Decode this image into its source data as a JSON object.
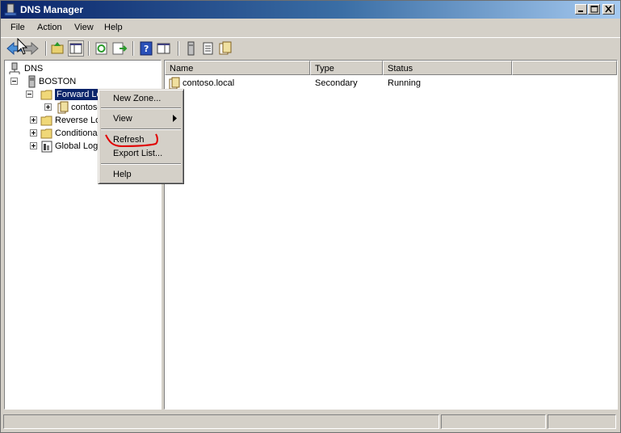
{
  "window": {
    "title": "DNS Manager"
  },
  "menu": [
    "File",
    "Action",
    "View",
    "Help"
  ],
  "tree": {
    "root": "DNS",
    "server": "BOSTON",
    "forward": "Forward Lo",
    "zone": "contoso",
    "reverse": "Reverse Lo",
    "conditional": "Conditional",
    "global_logs": "Global Logs"
  },
  "list": {
    "columns": [
      "Name",
      "Type",
      "Status"
    ],
    "rows": [
      {
        "name": "contoso.local",
        "type": "Secondary",
        "status": "Running"
      }
    ]
  },
  "context_menu": {
    "items": [
      "New Zone...",
      "View",
      "Refresh",
      "Export List...",
      "Help"
    ]
  },
  "colors": {
    "selection": "#0a246a",
    "annotation": "#e00000",
    "face": "#d4d0c8"
  }
}
